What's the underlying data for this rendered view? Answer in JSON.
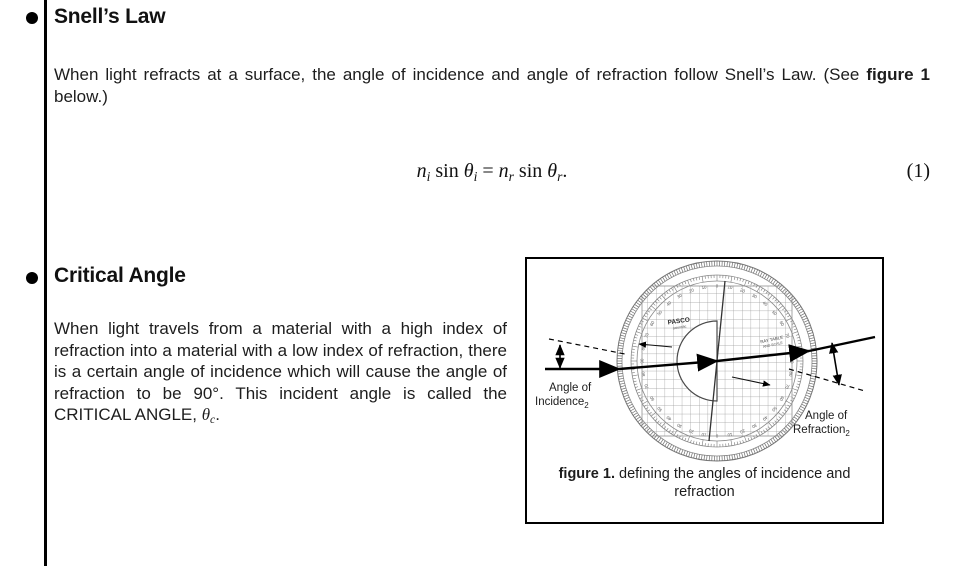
{
  "document": {
    "sections": [
      {
        "bullet": "●",
        "title": "Snell’s Law",
        "paragraph_html": "When light refracts at a surface, the angle of incidence and angle of refraction follow Snell’s Law. (See <b>figure 1</b> below.)"
      },
      {
        "bullet": "●",
        "title": "Critical Angle",
        "paragraph_html": "When light travels from a material with a high index of refraction into a material with a low index of refraction, there is a certain angle of incidence which will cause the angle of refraction to be 90°. This incident angle is called the CRITICAL ANGLE, <span class=\"theta\">θ</span><span class=\"inline-sub\">c</span>."
      }
    ],
    "equation": {
      "html": "<span class=\"it\">n</span><span class=\"sub\">i</span> <span class=\"up\">sin</span> <span class=\"it\">θ</span><span class=\"sub\">i</span> = <span class=\"it\">n</span><span class=\"sub\">r</span> <span class=\"up\">sin</span> <span class=\"it\">θ</span><span class=\"sub\">r</span>.",
      "plain": "n_i sin θ_i = n_r sin θ_r.",
      "number": "(1)"
    },
    "figure": {
      "caption_html": "<b>figure 1.</b> defining the angles of incidence and refraction",
      "caption_plain": "figure 1. defining the angles of incidence and refraction",
      "labels": {
        "incidence": "Angle of",
        "incidence_line2": "Incidence",
        "incidence_subscript": "2",
        "refraction": "Angle of",
        "refraction_line2": "Refraction",
        "refraction_subscript": "2"
      },
      "device": {
        "brand": "PASCO",
        "brand_sub": "scientific",
        "table_label_line1": "RAY TABLE",
        "table_label_line2": "AND SCALE"
      },
      "protractor": {
        "tick_numbers_top": [
          "60",
          "70",
          "80",
          "90",
          "80",
          "70",
          "60"
        ],
        "tick_numbers_bottom": [
          "60",
          "70",
          "80",
          "90",
          "80",
          "70",
          "60"
        ],
        "tick_numbers_side": [
          "50",
          "40",
          "30",
          "20",
          "10",
          "0",
          "10",
          "20",
          "30",
          "40",
          "50"
        ],
        "max_angle": 90,
        "angle_step": 10
      },
      "colors": {
        "border": "#000000",
        "ray": "#000000",
        "grid": "#8a8a8a",
        "rim": "#6f6f6f"
      }
    }
  }
}
